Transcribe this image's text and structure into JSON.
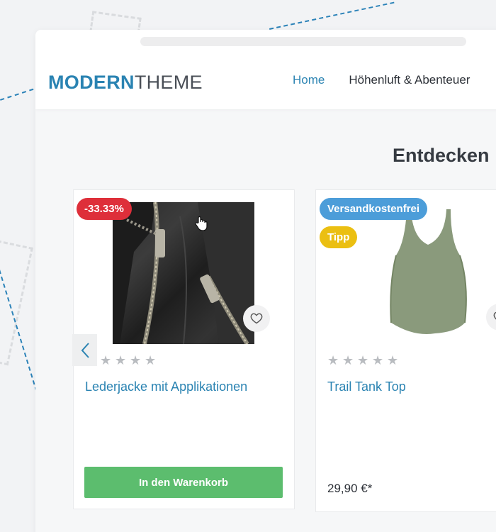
{
  "logo": {
    "part1": "MODERN",
    "part2": "THEME"
  },
  "nav": {
    "home": "Home",
    "adventure": "Höhenluft & Abenteuer"
  },
  "section": {
    "title": "Entdecken"
  },
  "products": [
    {
      "badge": "-33.33%",
      "name": "Lederjacke mit Applikationen",
      "rating": 0,
      "button": "In den Warenkorb"
    },
    {
      "badges": [
        "Versandkostenfrei",
        "Tipp"
      ],
      "name": "Trail Tank Top",
      "rating": 0,
      "price": "29,90 €*"
    }
  ],
  "colors": {
    "brand": "#2a83b2",
    "discount": "#de2f3a",
    "shipping": "#4c9dd9",
    "tip": "#ebbf12",
    "cart": "#5cbd6e"
  },
  "icons": {
    "wishlist": "heart-icon",
    "prev": "chevron-left-icon",
    "star": "star-icon"
  }
}
